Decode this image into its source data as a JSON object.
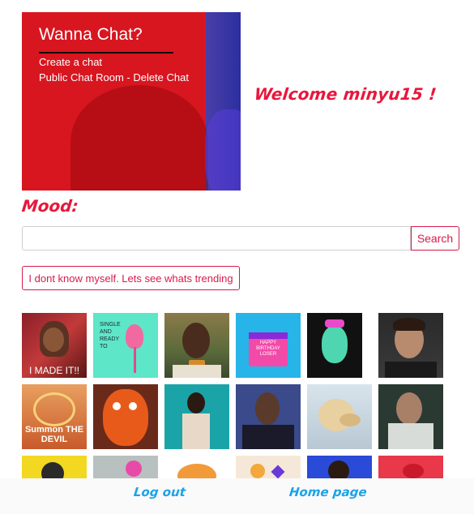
{
  "chat_panel": {
    "title": "Wanna Chat?",
    "create_link": "Create a chat",
    "public_link": "Public Chat Room - Delete Chat"
  },
  "welcome_text": "Welcome minyu15 !",
  "mood_label": "Mood:",
  "search": {
    "placeholder": "",
    "value": "",
    "button_label": "Search"
  },
  "trending_button": "I dont know myself. Lets see whats trending",
  "gifs": [
    {
      "name": "gif-i-made-it",
      "caption": "I MADE IT!!"
    },
    {
      "name": "gif-flamingo-single",
      "caption": "SINGLE AND READY TO"
    },
    {
      "name": "gif-man-bowtie",
      "caption": ""
    },
    {
      "name": "gif-birthday-cake",
      "caption": "HAPPY BIRTHDAY LOSER"
    },
    {
      "name": "gif-green-monster",
      "caption": ""
    },
    {
      "name": "gif-man-portrait",
      "caption": ""
    },
    {
      "name": "gif-summon-the-devil",
      "caption": "Summon THE DEVIL"
    },
    {
      "name": "gif-orange-mascot",
      "caption": ""
    },
    {
      "name": "gif-woman-dancing",
      "caption": ""
    },
    {
      "name": "gif-man-suit-news",
      "caption": ""
    },
    {
      "name": "gif-dog",
      "caption": ""
    },
    {
      "name": "gif-man-lab",
      "caption": ""
    },
    {
      "name": "gif-yellow-partial",
      "caption": ""
    },
    {
      "name": "gif-grey-partial",
      "caption": ""
    },
    {
      "name": "gif-pumpkin-partial",
      "caption": ""
    },
    {
      "name": "gif-moon-partial",
      "caption": ""
    },
    {
      "name": "gif-blue-partial",
      "caption": ""
    },
    {
      "name": "gif-red-partial",
      "caption": ""
    }
  ],
  "footer": {
    "logout": "Log out",
    "home": "Home page"
  },
  "colors": {
    "accent": "#e8173c",
    "link": "#1aa3e8",
    "panel": "#d81620"
  }
}
